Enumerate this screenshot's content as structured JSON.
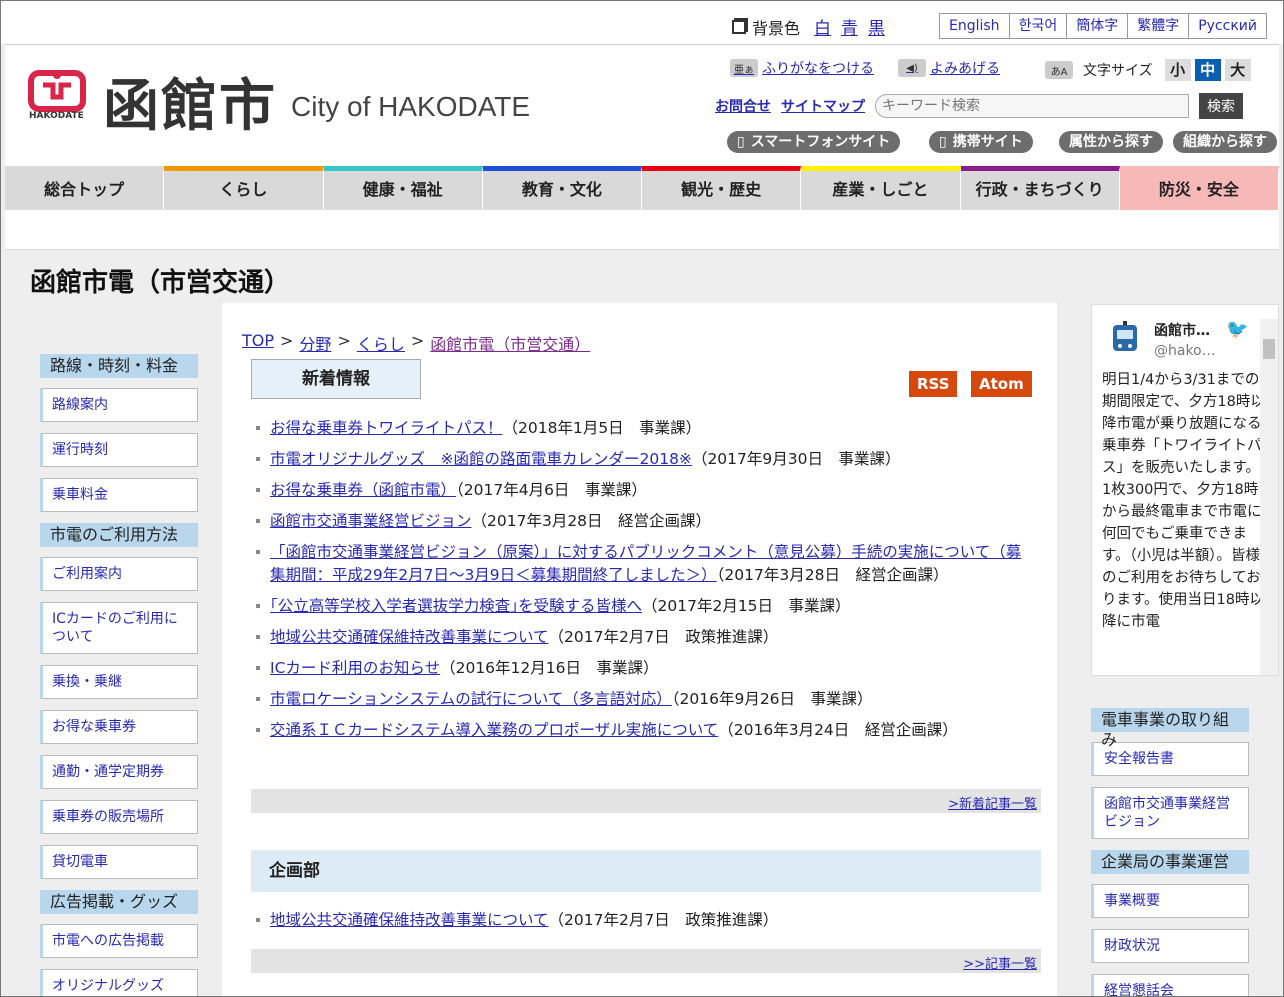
{
  "topbar": {
    "bgcolor_label": "背景色",
    "bg_options": [
      "白",
      "青",
      "黒"
    ],
    "languages": [
      "English",
      "한국어",
      "簡体字",
      "繁體字",
      "Русский"
    ]
  },
  "header": {
    "logo_kanji": "函館市",
    "logo_english": "City of HAKODATE",
    "logo_small": "HAKODATE",
    "furigana": "ふりがなをつける",
    "yomiageru": "よみあげる",
    "fontsize_label": "文字サイズ",
    "fontsize_options": [
      "小",
      "中",
      "大"
    ],
    "contact": "お問合せ",
    "sitemap": "サイトマップ",
    "search_placeholder": "キーワード検索",
    "search_button": "検索",
    "pills": [
      "スマートフォンサイト",
      "携帯サイト",
      "属性から探す",
      "組織から探す"
    ]
  },
  "gnav": [
    {
      "label": "総合トップ",
      "color": "#d9d9d9"
    },
    {
      "label": "くらし",
      "color": "#f39800"
    },
    {
      "label": "健康・福祉",
      "color": "#32c7c7"
    },
    {
      "label": "教育・文化",
      "color": "#1f4fd8"
    },
    {
      "label": "観光・歴史",
      "color": "#e60012"
    },
    {
      "label": "産業・しごと",
      "color": "#fff100"
    },
    {
      "label": "行政・まちづくり",
      "color": "#8b1a8b"
    },
    {
      "label": "防災・安全",
      "color": "#f7a6a6"
    }
  ],
  "page_title": "函館市電（市営交通）",
  "left_sidebar": [
    {
      "heading": "路線・時刻・料金",
      "items": [
        "路線案内",
        "運行時刻",
        "乗車料金"
      ]
    },
    {
      "heading": "市電のご利用方法",
      "items": [
        "ご利用案内",
        "ICカードのご利用について",
        "乗換・乗継",
        "お得な乗車券",
        "通勤・通学定期券",
        "乗車券の販売場所",
        "貸切電車"
      ]
    },
    {
      "heading": "広告掲載・グッズ",
      "items": [
        "市電への広告掲載",
        "オリジナルグッズ"
      ]
    }
  ],
  "breadcrumb": [
    "TOP",
    "分野",
    "くらし",
    "函館市電（市営交通）"
  ],
  "breadcrumb_sep": ">",
  "news": {
    "tab_label": "新着情報",
    "rss": "RSS",
    "atom": "Atom",
    "items": [
      {
        "title": "お得な乗車券トワイライトパス！",
        "meta": "（2018年1月5日　事業課）"
      },
      {
        "title": "市電オリジナルグッズ　※函館の路面電車カレンダー2018※",
        "meta": "（2017年9月30日　事業課）"
      },
      {
        "title": "お得な乗車券（函館市電）",
        "meta": "（2017年4月6日　事業課）"
      },
      {
        "title": "函館市交通事業経営ビジョン",
        "meta": "（2017年3月28日　経営企画課）"
      },
      {
        "title": "「函館市交通事業経営ビジョン（原案）」に対するパブリックコメント（意見公募）手続の実施について（募集期間：平成29年2月7日～3月9日＜募集期間終了しました＞）",
        "meta": "（2017年3月28日　経営企画課）"
      },
      {
        "title": "｢公立高等学校入学者選抜学力検査｣を受験する皆様へ",
        "meta": "（2017年2月15日　事業課）"
      },
      {
        "title": "地域公共交通確保維持改善事業について",
        "meta": "（2017年2月7日　政策推進課）"
      },
      {
        "title": "ICカード利用のお知らせ",
        "meta": "（2016年12月16日　事業課）"
      },
      {
        "title": "市電ロケーションシステムの試行について（多言語対応）",
        "meta": "（2016年9月26日　事業課）"
      },
      {
        "title": "交通系ＩＣカードシステム導入業務のプロポーザル実施について",
        "meta": "（2016年3月24日　経営企画課）"
      }
    ],
    "more_label": ">新着記事一覧"
  },
  "dept": {
    "heading": "企画部",
    "items": [
      {
        "title": "地域公共交通確保維持改善事業について",
        "meta": "（2017年2月7日　政策推進課）"
      }
    ],
    "more_label": ">>記事一覧"
  },
  "twitter": {
    "name": "函館市…",
    "handle": "@hako…",
    "text": "明日1/4から3/31までの期間限定で、夕方18時以降市電が乗り放題になる乗車券「トワイライトパス」を販売いたします。1枚300円で、夕方18時から最終電車まで市電に何回でもご乗車できます。（小児は半額）。皆様のご利用をお待ちしております。使用当日18時以降に市電"
  },
  "right_sidebar": [
    {
      "heading": "電車事業の取り組み",
      "items": [
        "安全報告書",
        "函館市交通事業経営ビジョン"
      ]
    },
    {
      "heading": "企業局の事業運営",
      "items": [
        "事業概要",
        "財政状況",
        "経営懇話会"
      ]
    }
  ]
}
